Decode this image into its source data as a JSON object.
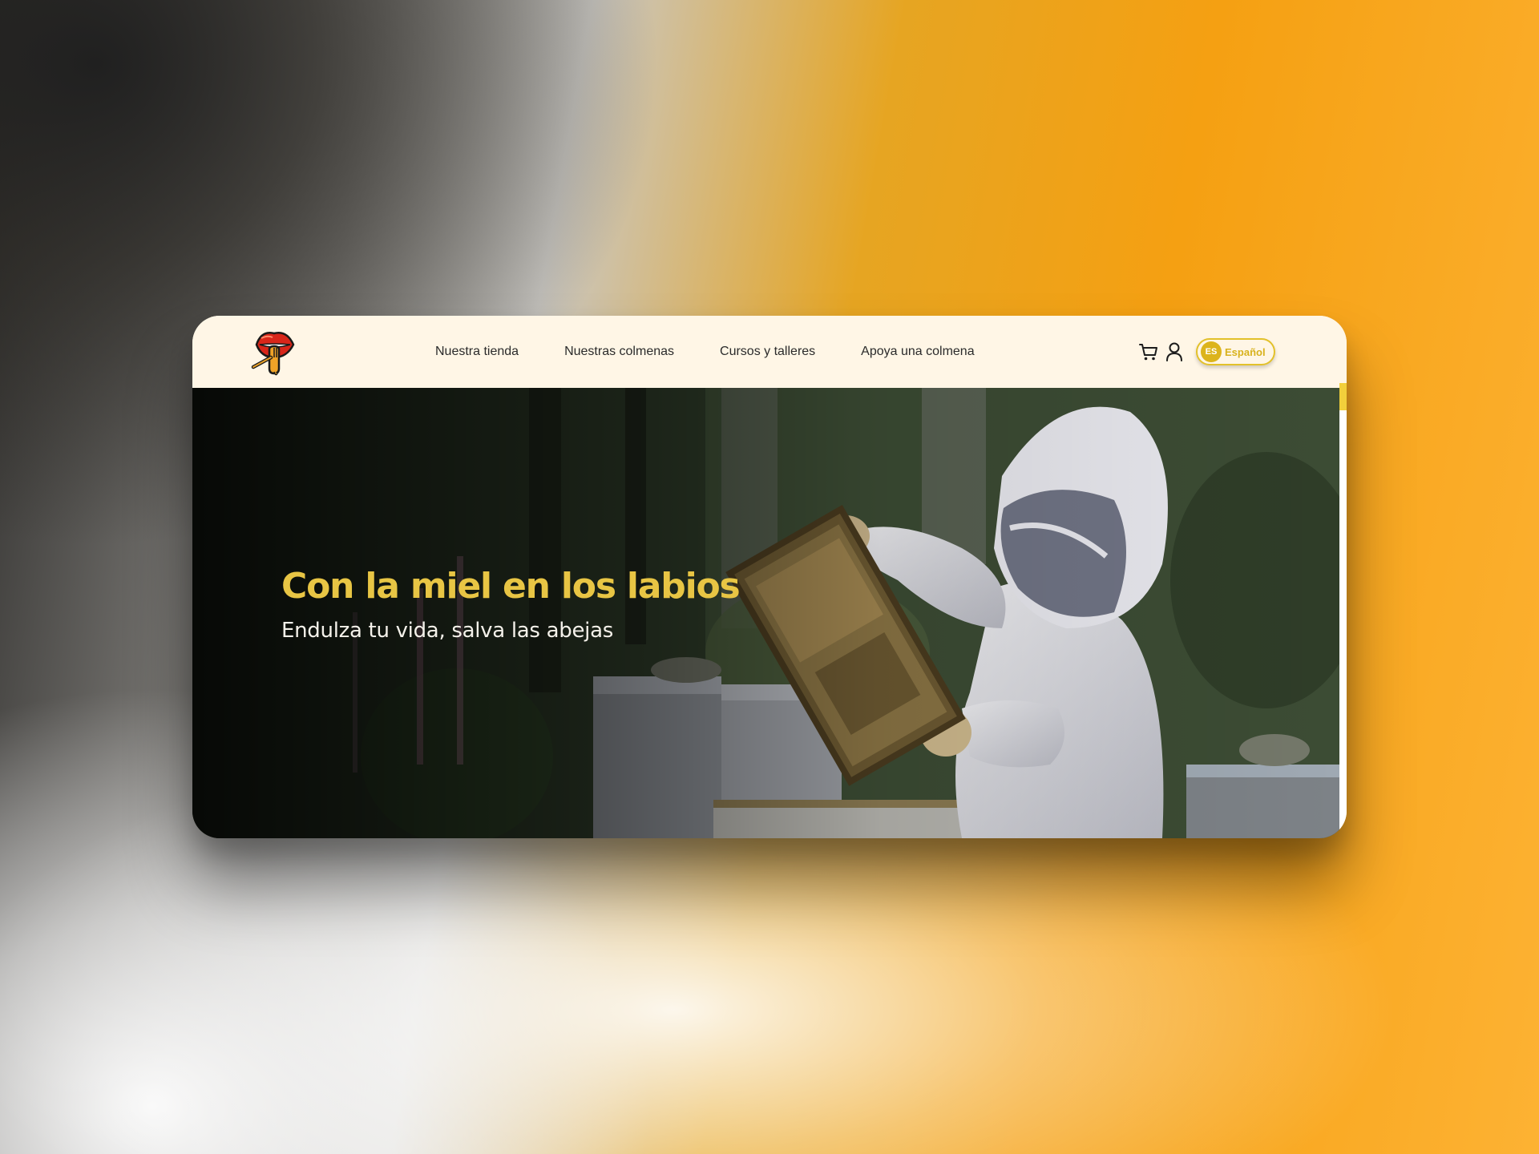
{
  "nav": {
    "logo_icon": "honey-lips-logo",
    "links": [
      {
        "label": "Nuestra tienda"
      },
      {
        "label": "Nuestras colmenas"
      },
      {
        "label": "Cursos y talleres"
      },
      {
        "label": "Apoya una colmena"
      }
    ],
    "cart_icon": "cart-icon",
    "user_icon": "user-icon",
    "language": {
      "code": "ES",
      "label": "Español"
    }
  },
  "hero": {
    "title": "Con la miel en los labios",
    "subtitle": "Endulza tu vida, salva las abejas",
    "image": "beekeeper-holding-honeycomb-frame"
  },
  "colors": {
    "accent_yellow": "#e8c544",
    "nav_background": "#fff6e6",
    "background_orange": "#f5a012"
  }
}
